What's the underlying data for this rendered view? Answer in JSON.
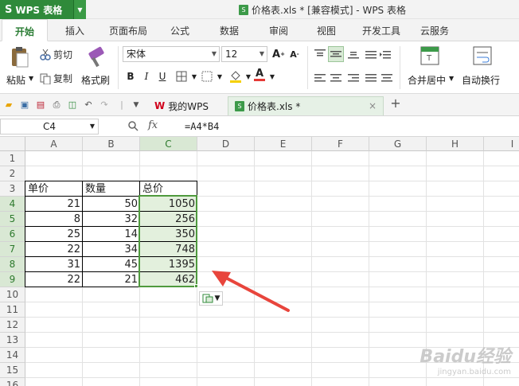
{
  "app": {
    "brand": "WPS 表格",
    "window_title": "价格表.xls * [兼容模式] - WPS 表格"
  },
  "ribbon_tabs": [
    "开始",
    "插入",
    "页面布局",
    "公式",
    "数据",
    "审阅",
    "视图",
    "开发工具",
    "云服务"
  ],
  "ribbon": {
    "paste": "粘贴",
    "cut": "剪切",
    "copy": "复制",
    "format_painter": "格式刷",
    "font_name": "宋体",
    "font_size": "12",
    "bold": "B",
    "italic": "I",
    "underline": "U",
    "merge_center": "合并居中",
    "wrap_text": "自动换行",
    "font_grow": "A",
    "font_shrink": "A",
    "font_color_letter": "A"
  },
  "doc_tabs": [
    {
      "label": "我的WPS",
      "active": false
    },
    {
      "label": "价格表.xls *",
      "active": true
    }
  ],
  "formula_bar": {
    "name_box": "C4",
    "fx_label": "fx",
    "formula": "=A4*B4"
  },
  "columns": [
    "A",
    "B",
    "C",
    "D",
    "E",
    "F",
    "G",
    "H",
    "I"
  ],
  "rows": [
    "1",
    "2",
    "3",
    "4",
    "5",
    "6",
    "7",
    "8",
    "9",
    "10",
    "11",
    "12",
    "13",
    "14",
    "15",
    "16"
  ],
  "table": {
    "headers": [
      "单价",
      "数量",
      "总价"
    ],
    "data": [
      [
        "21",
        "50",
        "1050"
      ],
      [
        "8",
        "32",
        "256"
      ],
      [
        "25",
        "14",
        "350"
      ],
      [
        "22",
        "34",
        "748"
      ],
      [
        "31",
        "45",
        "1395"
      ],
      [
        "22",
        "21",
        "462"
      ]
    ]
  },
  "watermark": {
    "brand": "Baidu经验",
    "url": "jingyan.baidu.com"
  },
  "colors": {
    "brand_green": "#2f8a3a",
    "selection_green": "#4f9a3e",
    "arrow_red": "#e8453c"
  }
}
